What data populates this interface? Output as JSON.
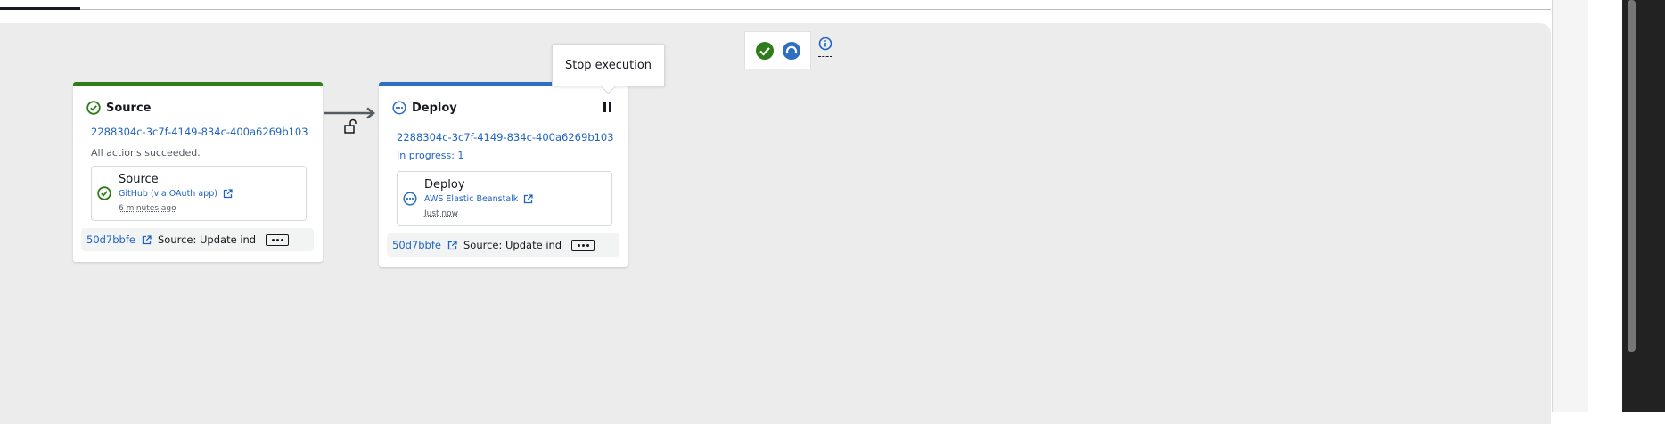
{
  "colors": {
    "success": "#2e7d1a",
    "in_progress": "#2f6fc0",
    "link": "#1f63c4"
  },
  "tooltip": {
    "text": "Stop execution"
  },
  "stages": [
    {
      "name": "Source",
      "status_icon": "check-circle-icon",
      "execution_id": "2288304c-3c7f-4149-834c-400a6269b103",
      "status_text": "All actions succeeded.",
      "action": {
        "name": "Source",
        "provider": "GitHub (via OAuth app)",
        "time": "6 minutes ago",
        "status_icon": "check-circle-icon"
      },
      "commit": {
        "id": "50d7bbfe",
        "message": "Source: Update ind"
      }
    },
    {
      "name": "Deploy",
      "status_icon": "in-progress-icon",
      "execution_id": "2288304c-3c7f-4149-834c-400a6269b103",
      "status_text": "In progress: 1",
      "action": {
        "name": "Deploy",
        "provider": "AWS Elastic Beanstalk",
        "time": "Just now",
        "status_icon": "in-progress-icon"
      },
      "commit": {
        "id": "50d7bbfe",
        "message": "Source: Update ind"
      }
    }
  ]
}
